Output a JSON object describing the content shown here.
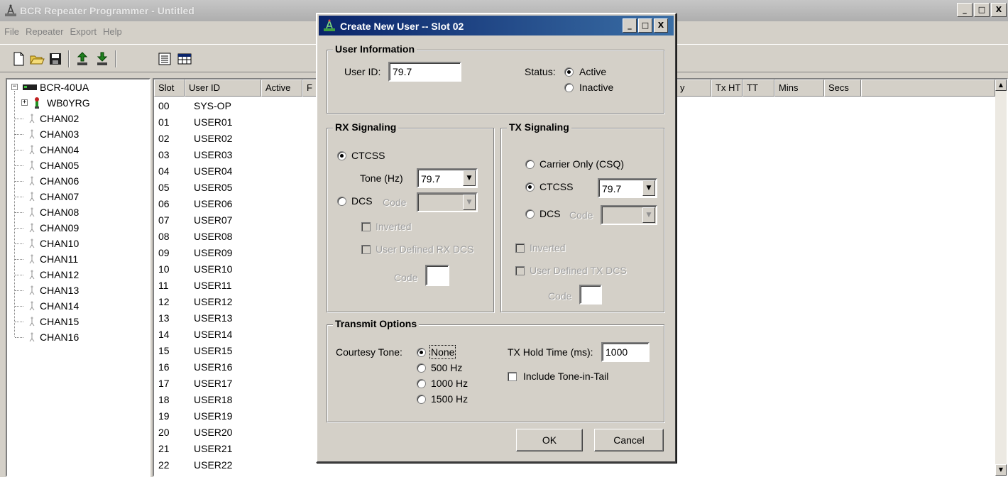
{
  "main_window": {
    "title": "BCR Repeater Programmer - Untitled",
    "controls": {
      "minimize": "_",
      "maximize": "□",
      "close": "X"
    }
  },
  "menu": [
    "File",
    "Repeater",
    "Export",
    "Help"
  ],
  "toolbar": {
    "buttons": [
      "new-icon",
      "open-icon",
      "save-icon",
      "upload-icon",
      "download-icon",
      "list-view-icon",
      "table-view-icon"
    ]
  },
  "tree": {
    "root": "BCR-40UA",
    "repeater": "WB0YRG",
    "channels": [
      "CHAN02",
      "CHAN03",
      "CHAN04",
      "CHAN05",
      "CHAN06",
      "CHAN07",
      "CHAN08",
      "CHAN09",
      "CHAN10",
      "CHAN11",
      "CHAN12",
      "CHAN13",
      "CHAN14",
      "CHAN15",
      "CHAN16"
    ]
  },
  "user_list": {
    "columns": {
      "slot": "Slot",
      "user_id": "User ID",
      "active": "Active",
      "f": "F",
      "y": "y",
      "txht": "Tx HT",
      "tt": "TT",
      "mins": "Mins",
      "secs": "Secs"
    },
    "rows": [
      {
        "slot": "00",
        "user": "SYS-OP"
      },
      {
        "slot": "01",
        "user": "USER01"
      },
      {
        "slot": "02",
        "user": "USER02"
      },
      {
        "slot": "03",
        "user": "USER03"
      },
      {
        "slot": "04",
        "user": "USER04"
      },
      {
        "slot": "05",
        "user": "USER05"
      },
      {
        "slot": "06",
        "user": "USER06"
      },
      {
        "slot": "07",
        "user": "USER07"
      },
      {
        "slot": "08",
        "user": "USER08"
      },
      {
        "slot": "09",
        "user": "USER09"
      },
      {
        "slot": "10",
        "user": "USER10"
      },
      {
        "slot": "11",
        "user": "USER11"
      },
      {
        "slot": "12",
        "user": "USER12"
      },
      {
        "slot": "13",
        "user": "USER13"
      },
      {
        "slot": "14",
        "user": "USER14"
      },
      {
        "slot": "15",
        "user": "USER15"
      },
      {
        "slot": "16",
        "user": "USER16"
      },
      {
        "slot": "17",
        "user": "USER17"
      },
      {
        "slot": "18",
        "user": "USER18"
      },
      {
        "slot": "19",
        "user": "USER19"
      },
      {
        "slot": "20",
        "user": "USER20"
      },
      {
        "slot": "21",
        "user": "USER21"
      },
      {
        "slot": "22",
        "user": "USER22"
      }
    ]
  },
  "dialog": {
    "title": "Create New User -- Slot 02",
    "controls": {
      "minimize": "_",
      "maximize": "□",
      "close": "X"
    },
    "user_info": {
      "group_title": "User Information",
      "user_id_label": "User ID:",
      "user_id_value": "79.7",
      "status_label": "Status:",
      "active_label": "Active",
      "inactive_label": "Inactive",
      "status_selected": "Active"
    },
    "rx": {
      "group_title": "RX Signaling",
      "ctcss_label": "CTCSS",
      "tone_label": "Tone (Hz)",
      "tone_value": "79.7",
      "dcs_label": "DCS",
      "code_label": "Code",
      "inverted_label": "Inverted",
      "user_defined_label": "User Defined RX DCS",
      "code2_label": "Code",
      "selected": "CTCSS"
    },
    "tx": {
      "group_title": "TX Signaling",
      "carrier_label": "Carrier Only (CSQ)",
      "ctcss_label": "CTCSS",
      "ctcss_value": "79.7",
      "dcs_label": "DCS",
      "code_label": "Code",
      "inverted_label": "Inverted",
      "user_defined_label": "User Defined TX DCS",
      "code2_label": "Code",
      "selected": "CTCSS"
    },
    "transmit": {
      "group_title": "Transmit Options",
      "courtesy_label": "Courtesy Tone:",
      "tone_options": [
        "None",
        "500 Hz",
        "1000 Hz",
        "1500 Hz"
      ],
      "tone_selected": "None",
      "hold_label": "TX Hold Time (ms):",
      "hold_value": "1000",
      "tone_in_tail_label": "Include Tone-in-Tail",
      "tone_in_tail_checked": false
    },
    "buttons": {
      "ok": "OK",
      "cancel": "Cancel"
    }
  }
}
